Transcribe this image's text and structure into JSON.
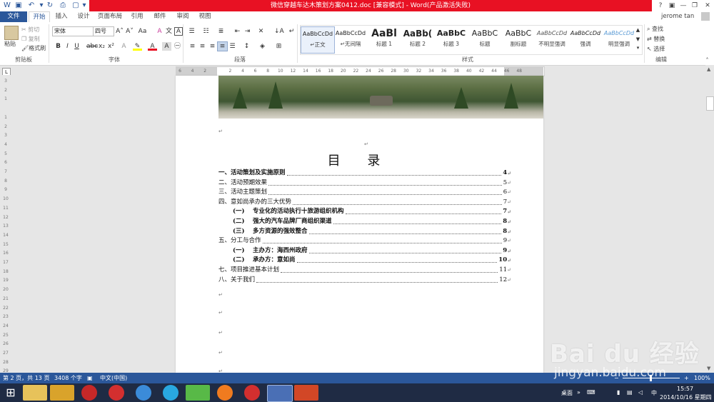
{
  "window": {
    "title": "微信穿越车达木策划方案0412.doc [兼容模式] - Word(产品激活失败)",
    "user": "jerome tan",
    "help_icon": "question-icon"
  },
  "tabs": [
    "文件",
    "开始",
    "插入",
    "设计",
    "页面布局",
    "引用",
    "邮件",
    "审阅",
    "视图"
  ],
  "ribbon": {
    "clipboard": {
      "paste": "粘贴",
      "cut": "剪切",
      "copy": "复制",
      "format_painter": "格式刷",
      "label": "剪贴板"
    },
    "font": {
      "name": "宋体",
      "size": "四号",
      "label": "字体"
    },
    "paragraph": {
      "label": "段落"
    },
    "styles": {
      "label": "样式",
      "items": [
        {
          "preview": "AaBbCcDd",
          "name": "↵正文"
        },
        {
          "preview": "AaBbCcDd",
          "name": "↵无间隔"
        },
        {
          "preview": "AaBl",
          "name": "标题 1"
        },
        {
          "preview": "AaBb(",
          "name": "标题 2"
        },
        {
          "preview": "AaBbC",
          "name": "标题 3"
        },
        {
          "preview": "AaBbC",
          "name": "标题"
        },
        {
          "preview": "AaBbC",
          "name": "副标题"
        },
        {
          "preview": "AaBbCcDd",
          "name": "不明显强调"
        },
        {
          "preview": "AaBbCcDd",
          "name": "强调"
        },
        {
          "preview": "AaBbCcDd",
          "name": "明显强调"
        }
      ]
    },
    "editing": {
      "find": "查找",
      "replace": "替换",
      "select": "选择",
      "label": "编辑"
    }
  },
  "ruler": {
    "h_marks": [
      "6",
      "4",
      "2",
      "",
      "2",
      "4",
      "6",
      "8",
      "10",
      "12",
      "14",
      "16",
      "18",
      "20",
      "22",
      "24",
      "26",
      "28",
      "30",
      "32",
      "34",
      "36",
      "38",
      "40",
      "42",
      "44",
      "46",
      "48"
    ],
    "v_marks": [
      "3",
      "2",
      "1",
      "",
      "1",
      "2",
      "3",
      "4",
      "5",
      "6",
      "7",
      "8",
      "9",
      "10",
      "11",
      "12",
      "13",
      "14",
      "15",
      "16",
      "17",
      "18",
      "19",
      "20",
      "21",
      "22",
      "23",
      "24",
      "25",
      "26",
      "27",
      "28",
      "29"
    ]
  },
  "document": {
    "toc_title": "目 录",
    "toc": [
      {
        "text": "一、活动策划及实施原则",
        "page": "4",
        "bold": true,
        "indent": false
      },
      {
        "text": "二、活动预期效果",
        "page": "5",
        "bold": false,
        "indent": false
      },
      {
        "text": "三、活动主题策划",
        "page": "6",
        "bold": false,
        "indent": false
      },
      {
        "text": "四、意如尚承办的三大优势",
        "page": "7",
        "bold": false,
        "indent": false
      },
      {
        "text": "(一)　 专业化的活动执行十旅游组织机构",
        "page": "7",
        "bold": true,
        "indent": true
      },
      {
        "text": "(二)　 强大的汽车品牌厂商组织渠道",
        "page": "8",
        "bold": true,
        "indent": true
      },
      {
        "text": "(三)　 多方资源的强效整合",
        "page": "8",
        "bold": true,
        "indent": true
      },
      {
        "text": "五、分工与合作",
        "page": "9",
        "bold": false,
        "indent": false
      },
      {
        "text": "(一)　 主办方：海西州政府",
        "page": "9",
        "bold": true,
        "indent": true
      },
      {
        "text": "(二)　 承办方：意如尚",
        "page": "10",
        "bold": true,
        "indent": true
      },
      {
        "text": "七、项目推进基本计划",
        "page": "11",
        "bold": false,
        "indent": false
      },
      {
        "text": "八、关于我们",
        "page": "12",
        "bold": false,
        "indent": false
      }
    ]
  },
  "status": {
    "page": "第 2 页，共 13 页",
    "words": "3408 个字",
    "language": "中文(中国)",
    "zoom": "100%"
  },
  "taskbar": {
    "desktop": "桌面",
    "ime": "中",
    "time": "15:57",
    "date": "2014/10/16 星期四"
  },
  "watermark": {
    "brand": "Bai du 经验",
    "url": "jingyan.baidu.com"
  },
  "colors": {
    "accent": "#2b579a",
    "title_error": "#e81123",
    "taskbar": "#1f2b44"
  }
}
